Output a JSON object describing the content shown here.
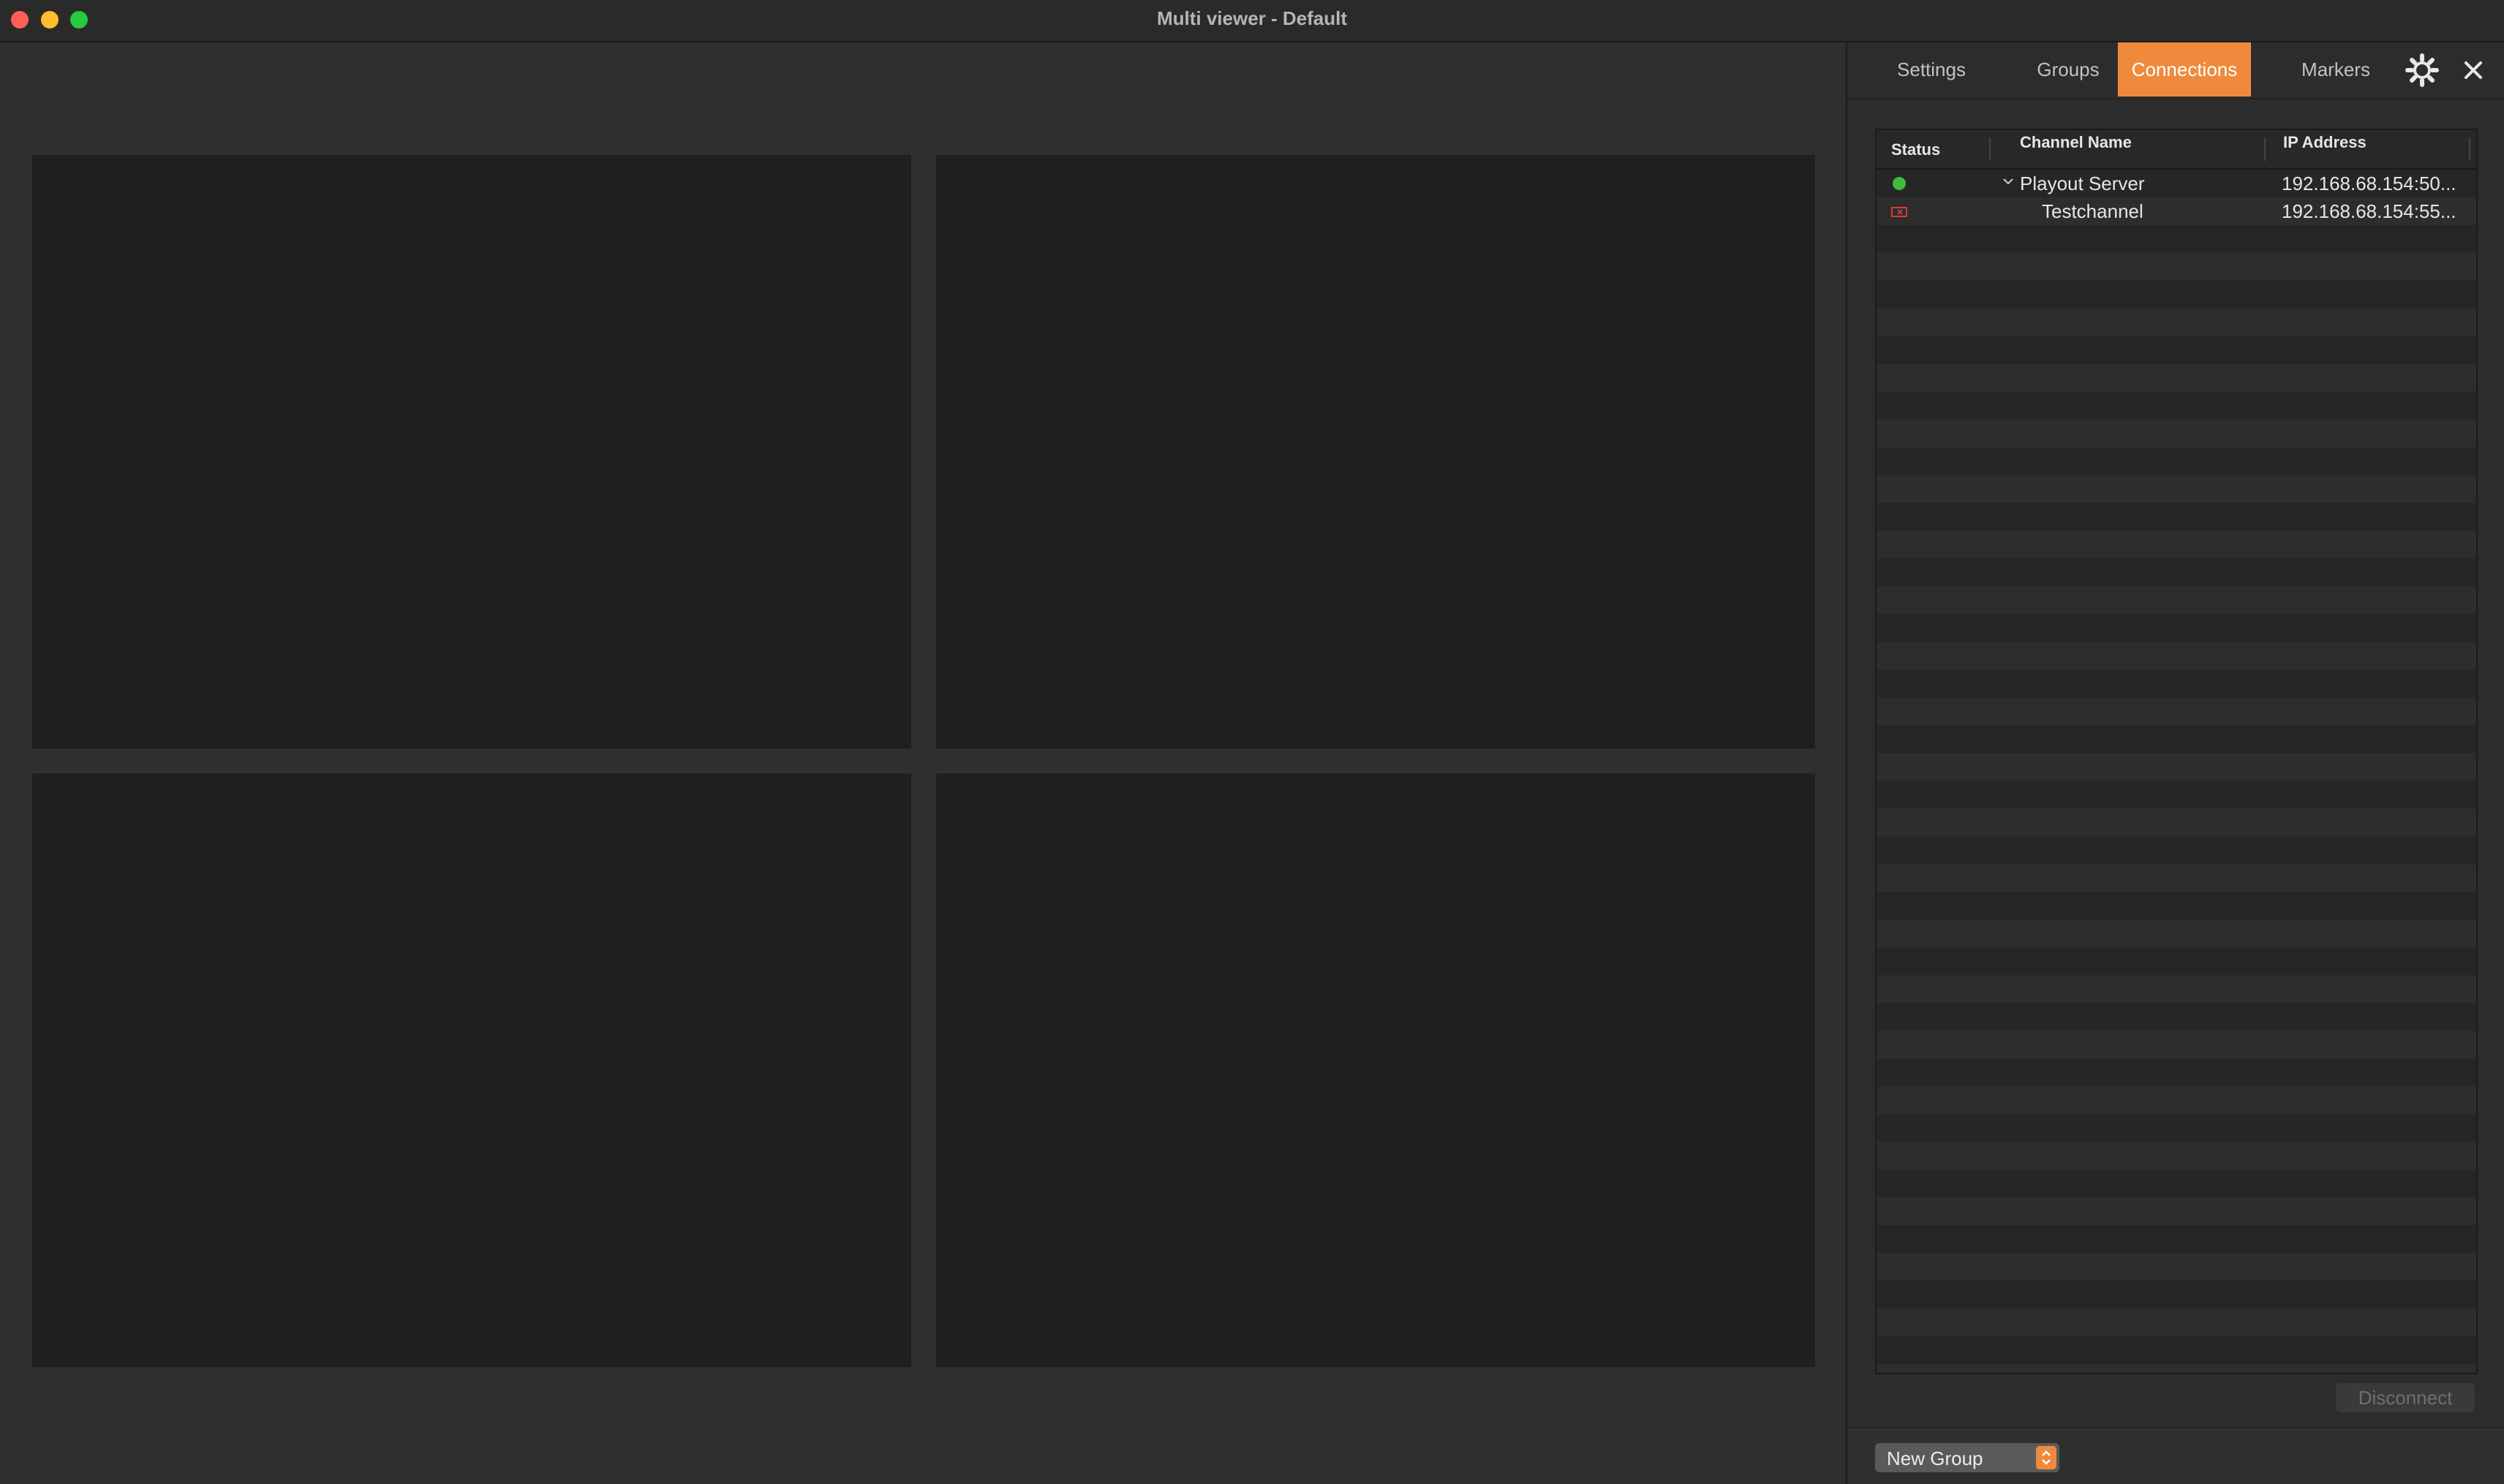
{
  "window": {
    "title": "Multi viewer - Default"
  },
  "tabs": [
    {
      "label": "Settings",
      "active": false
    },
    {
      "label": "Groups",
      "active": false
    },
    {
      "label": "Connections",
      "active": true
    },
    {
      "label": "Markers",
      "active": false
    }
  ],
  "toolbar_icons": [
    "gear-icon",
    "close-icon"
  ],
  "connections_table": {
    "columns": [
      "Status",
      "Channel Name",
      "IP Address"
    ],
    "rows": [
      {
        "status": "connected",
        "status_icon": "green-dot-icon",
        "expanded": true,
        "name": "Playout Server",
        "ip": "192.168.68.154:50..."
      },
      {
        "status": "error",
        "status_icon": "error-icon",
        "name": "Testchannel",
        "ip": "192.168.68.154:55..."
      }
    ]
  },
  "actions": {
    "disconnect_label": "Disconnect",
    "group_select_value": "New Group"
  },
  "colors": {
    "accent": "#ef8a3c",
    "connected": "#3dbb3d",
    "error": "#d83a3a"
  }
}
